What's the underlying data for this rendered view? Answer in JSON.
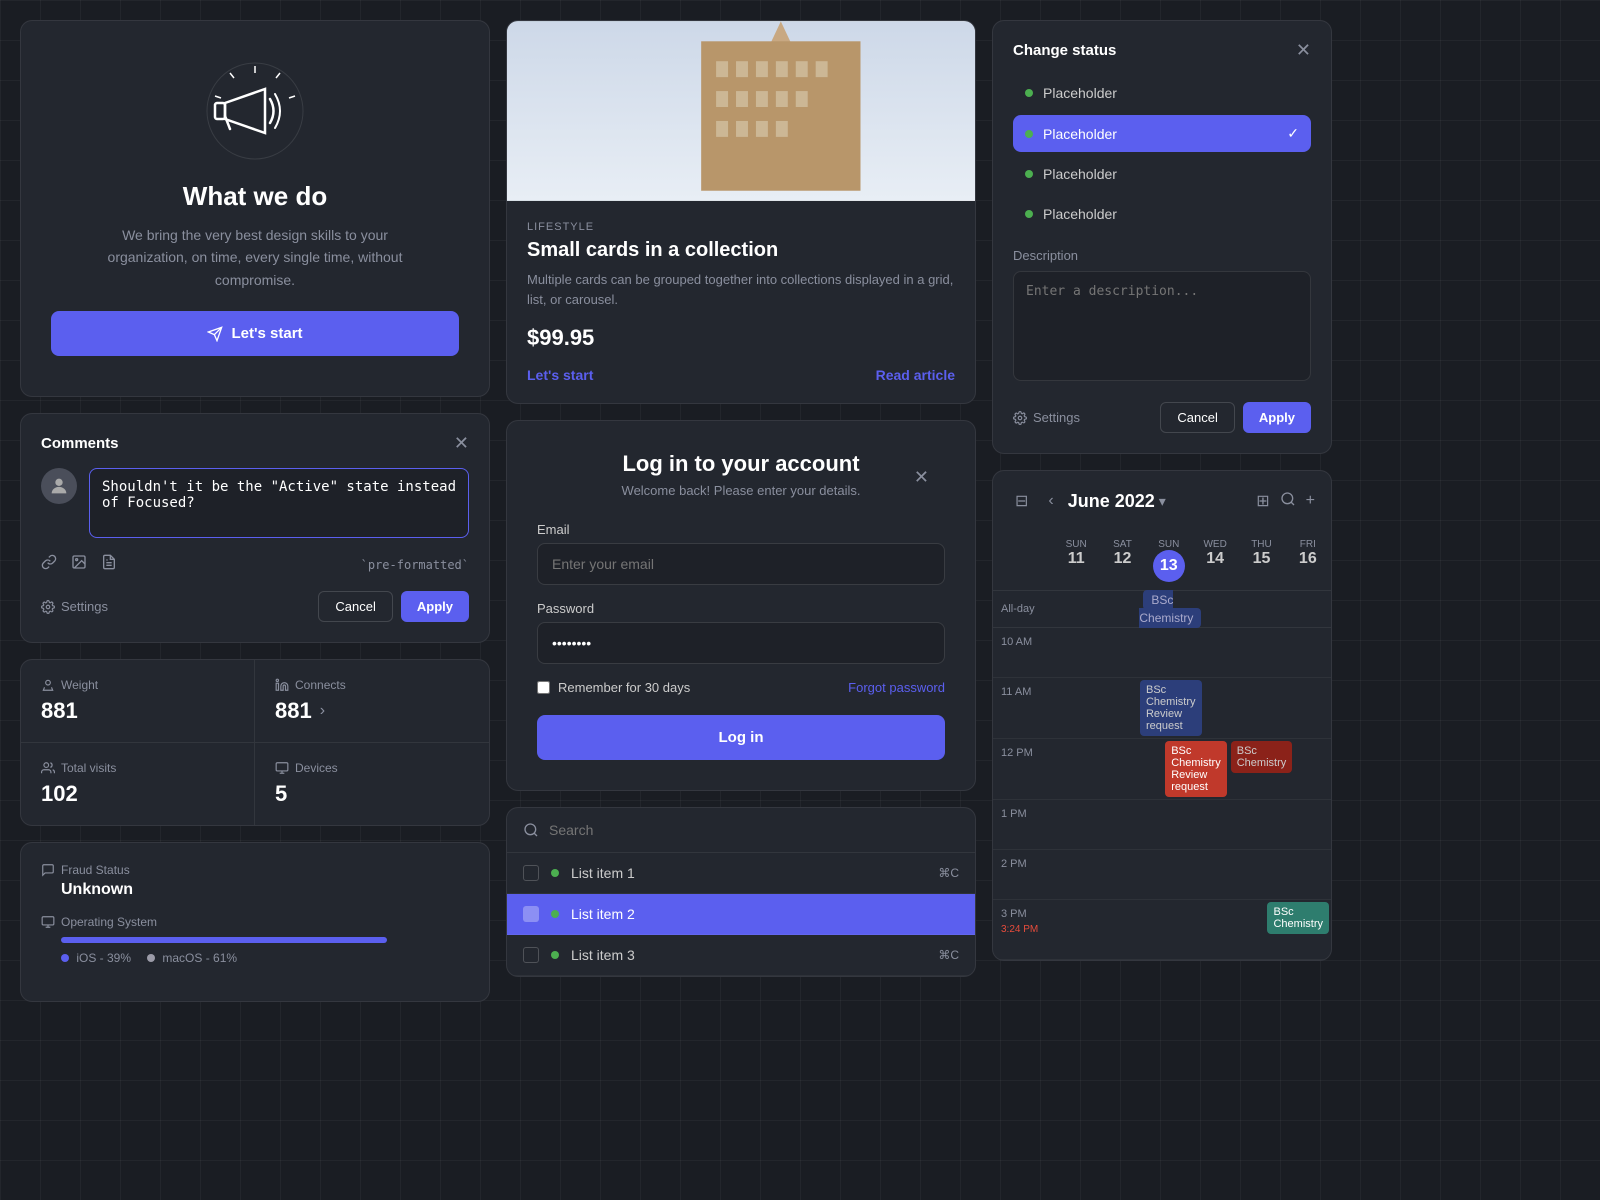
{
  "hero": {
    "title": "What we do",
    "description": "We bring the very best design skills to your organization, on time, every single time, without compromise.",
    "cta_label": "Let's start"
  },
  "comments": {
    "title": "Comments",
    "placeholder": "Shouldn't it be the \"Active\" state instead of Focused?",
    "format_hint": "`pre-formatted`",
    "cancel_label": "Cancel",
    "apply_label": "Apply",
    "settings_label": "Settings"
  },
  "stats": {
    "weight_label": "Weight",
    "weight_value": "881",
    "connects_label": "Connects",
    "connects_value": "881",
    "total_visits_label": "Total visits",
    "total_visits_value": "102",
    "devices_label": "Devices",
    "devices_value": "5"
  },
  "fraud": {
    "label": "Fraud Status",
    "value": "Unknown",
    "os_label": "Operating System",
    "os_ios": "iOS - 39%",
    "os_mac": "macOS - 61%"
  },
  "article": {
    "tag": "LIFESTYLE",
    "title": "Small cards in a collection",
    "description": "Multiple cards can be grouped together into collections displayed in a grid, list, or carousel.",
    "price": "$99.95",
    "lets_start": "Let's start",
    "read_article": "Read article"
  },
  "login": {
    "title": "Log in to your account",
    "subtitle": "Welcome back! Please enter your details.",
    "email_label": "Email",
    "email_placeholder": "Enter your email",
    "password_label": "Password",
    "password_value": "••••••••",
    "remember_label": "Remember for 30 days",
    "forgot_label": "Forgot password",
    "login_btn": "Log in"
  },
  "search": {
    "placeholder": "Search",
    "items": [
      {
        "label": "List item 1",
        "shortcut": "⌘C",
        "active": false
      },
      {
        "label": "List item 2",
        "shortcut": "",
        "active": true
      },
      {
        "label": "List item 3",
        "shortcut": "⌘C",
        "active": false
      }
    ]
  },
  "change_status": {
    "title": "Change status",
    "options": [
      {
        "label": "Placeholder",
        "selected": false
      },
      {
        "label": "Placeholder",
        "selected": true
      },
      {
        "label": "Placeholder",
        "selected": false
      },
      {
        "label": "Placeholder",
        "selected": false
      }
    ],
    "description_label": "Description",
    "description_placeholder": "Enter a description...",
    "cancel_label": "Cancel",
    "apply_label": "Apply",
    "settings_label": "Settings"
  },
  "calendar": {
    "month": "June 2022",
    "days": [
      {
        "name": "SUN",
        "num": "11"
      },
      {
        "name": "SAT",
        "num": "12"
      },
      {
        "name": "SUN",
        "num": "13",
        "today": true
      },
      {
        "name": "WED",
        "num": "14"
      },
      {
        "name": "THU",
        "num": "15"
      },
      {
        "name": "FRI",
        "num": "16"
      }
    ],
    "allday_event": "BSc Chemistry",
    "events": [
      {
        "time": "11 AM",
        "label": "BSc Chemistry\nReview request",
        "type": "dark-blue"
      },
      {
        "time": "12 PM",
        "label": "BSc Chemistry\nReview request",
        "type": "red"
      },
      {
        "time": "12 PM",
        "label": "BSc Chemistry",
        "type": "dark-red"
      },
      {
        "time": "3:24 PM",
        "label": "BSc Chemistry",
        "type": "teal"
      }
    ]
  }
}
